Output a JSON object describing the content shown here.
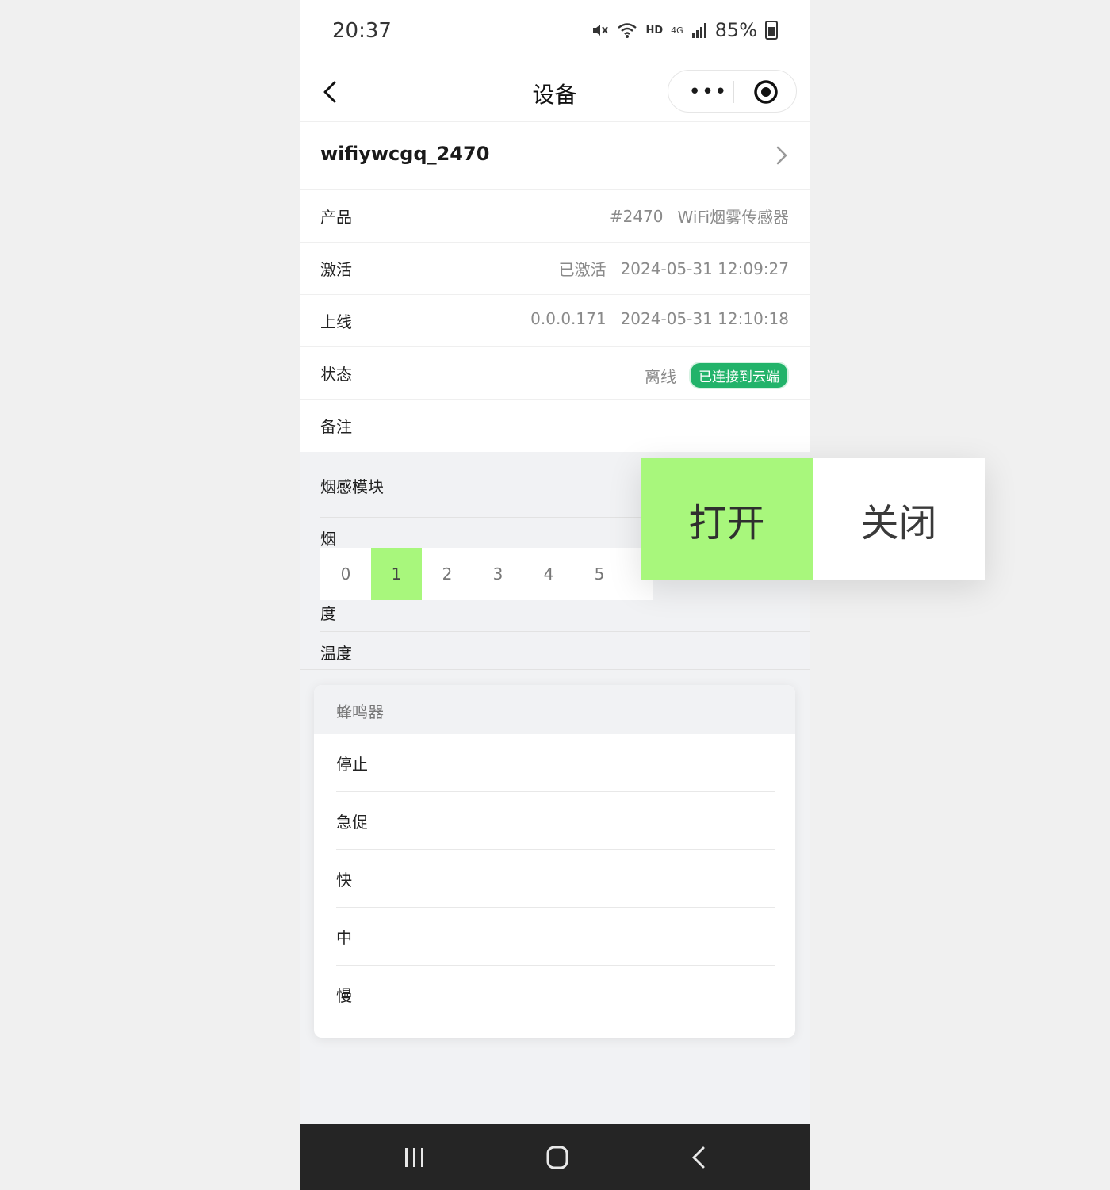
{
  "status_bar": {
    "time": "20:37",
    "hd": "HD",
    "network": "4G",
    "battery": "85%"
  },
  "nav": {
    "title": "设备",
    "more": "•••"
  },
  "device": {
    "name": "wifiywcgq_2470"
  },
  "info_rows": [
    {
      "label": "产品",
      "values": [
        "#2470",
        "WiFi烟雾传感器"
      ]
    },
    {
      "label": "激活",
      "values": [
        "已激活",
        "2024-05-31 12:09:27"
      ]
    },
    {
      "label": "上线",
      "values": [
        "0.0.0.171",
        "2024-05-31 12:10:18"
      ]
    },
    {
      "label": "状态",
      "values": [
        "离线"
      ],
      "badge": "已连接到云端"
    },
    {
      "label": "备注",
      "values": []
    }
  ],
  "smoke_module": {
    "title": "烟感模块",
    "smoke_label_top": "烟",
    "smoke_label_bottom": "度",
    "levels": [
      "0",
      "1",
      "2",
      "3",
      "4",
      "5"
    ],
    "selected_level": "1",
    "temperature_label": "温度"
  },
  "buzzer": {
    "title": "蜂鸣器",
    "options": [
      "停止",
      "急促",
      "快",
      "中",
      "慢"
    ]
  },
  "overlay": {
    "on_label": "打开",
    "off_label": "关闭",
    "selected": "打开"
  },
  "colors": {
    "accent_green": "#a8f77c",
    "badge_green": "#22b36a"
  }
}
